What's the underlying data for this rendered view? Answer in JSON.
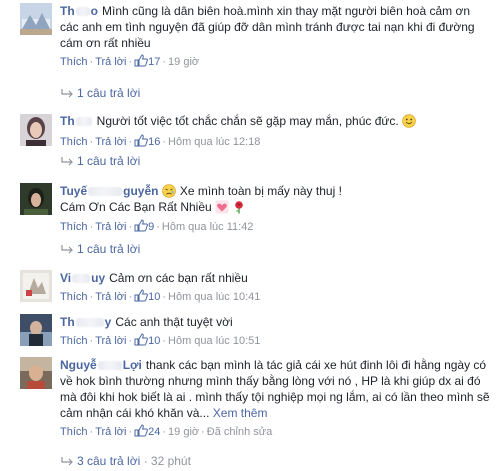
{
  "comments": [
    {
      "name": "Th",
      "name_tail": "o",
      "text": "Mình cũng là dân biên hoà.mình xin thay mặt người biên hoà cảm ơn các anh em tình nguyện đã giúp đỡ dân mình tránh được tai nạn khi đi đường cám ơn rất nhiều",
      "like": "Thích",
      "reply": "Trả lời",
      "likes": "17",
      "time": "19 giờ",
      "replies": "1 câu trả lời"
    },
    {
      "name": "Th",
      "text": "Người tốt việc tốt chắc chắn sẽ gặp may mắn, phúc đức.",
      "like": "Thích",
      "reply": "Trả lời",
      "likes": "16",
      "time": "Hôm qua lúc 12:18",
      "replies": "1 câu trả lời"
    },
    {
      "name": "Tuyế",
      "name_tail": "guyễn",
      "text": "Xe mình toàn bị mấy này thuj !",
      "text2": "Cám Ơn Các Bạn Rất Nhiều",
      "like": "Thích",
      "reply": "Trả lời",
      "likes": "9",
      "time": "Hôm qua lúc 11:42",
      "replies": "1 câu trả lời"
    },
    {
      "name": "Vi",
      "name_tail": "uy",
      "text": "Cảm ơn các bạn rất nhiều",
      "like": "Thích",
      "reply": "Trả lời",
      "likes": "10",
      "time": "Hôm qua lúc 10:41"
    },
    {
      "name": "Th",
      "name_tail": "y",
      "text": "Các anh thật tuyệt vời",
      "like": "Thích",
      "reply": "Trả lời",
      "likes": "10",
      "time": "Hôm qua lúc 10:51"
    },
    {
      "name": "Nguyễ",
      "name_tail": "Lợi",
      "text": "thank các bạn mình là tác giả cái xe hút đinh lôi đi hằng ngày có về hok bình thường nhưng mình thấy bằng lòng với nó , HP là khi giúp dx ai đó mà đôi khi hok biết là ai . mình thấy tội nghiệp mọi ng lắm, ai có lần theo mình sẽ cảm nhận cái khó khăn và...",
      "see_more": "Xem thêm",
      "like": "Thích",
      "reply": "Trả lời",
      "likes": "24",
      "time": "19 giờ",
      "edited": "Đã chỉnh sửa",
      "replies": "3 câu trả lời",
      "replies_time": "32 phút"
    }
  ],
  "colors": {
    "link": "#4b67a1",
    "meta": "#90949c",
    "text": "#1d2129"
  },
  "icons": {
    "like": "thumbs-up-icon",
    "reply": "reply-arrow-icon",
    "smile": "smile-emoji-icon",
    "sad": "sad-emoji-icon",
    "heart": "heart-emoji-icon",
    "rose": "rose-emoji-icon"
  }
}
